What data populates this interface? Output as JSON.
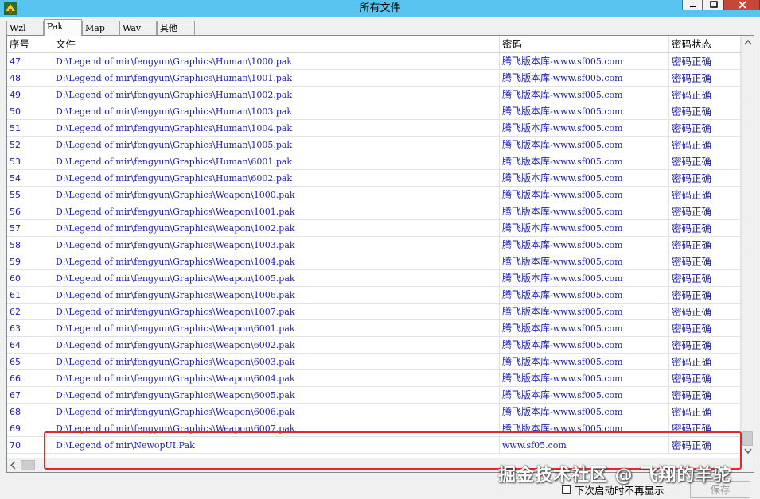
{
  "window": {
    "title": "所有文件"
  },
  "tabs": [
    {
      "label": "Wzl"
    },
    {
      "label": "Pak"
    },
    {
      "label": "Map"
    },
    {
      "label": "Wav"
    },
    {
      "label": "其他"
    }
  ],
  "table": {
    "columns": [
      "序号",
      "文件",
      "密码",
      "密码状态"
    ],
    "rows": [
      {
        "id": "47",
        "file": "D:\\Legend of mir\\fengyun\\Graphics\\Human\\1000.pak",
        "password_cn": "腾飞版本库",
        "password_rest": "-www.sf005.com",
        "status": "密码正确"
      },
      {
        "id": "48",
        "file": "D:\\Legend of mir\\fengyun\\Graphics\\Human\\1001.pak",
        "password_cn": "腾飞版本库",
        "password_rest": "-www.sf005.com",
        "status": "密码正确"
      },
      {
        "id": "49",
        "file": "D:\\Legend of mir\\fengyun\\Graphics\\Human\\1002.pak",
        "password_cn": "腾飞版本库",
        "password_rest": "-www.sf005.com",
        "status": "密码正确"
      },
      {
        "id": "50",
        "file": "D:\\Legend of mir\\fengyun\\Graphics\\Human\\1003.pak",
        "password_cn": "腾飞版本库",
        "password_rest": "-www.sf005.com",
        "status": "密码正确"
      },
      {
        "id": "51",
        "file": "D:\\Legend of mir\\fengyun\\Graphics\\Human\\1004.pak",
        "password_cn": "腾飞版本库",
        "password_rest": "-www.sf005.com",
        "status": "密码正确"
      },
      {
        "id": "52",
        "file": "D:\\Legend of mir\\fengyun\\Graphics\\Human\\1005.pak",
        "password_cn": "腾飞版本库",
        "password_rest": "-www.sf005.com",
        "status": "密码正确"
      },
      {
        "id": "53",
        "file": "D:\\Legend of mir\\fengyun\\Graphics\\Human\\6001.pak",
        "password_cn": "腾飞版本库",
        "password_rest": "-www.sf005.com",
        "status": "密码正确"
      },
      {
        "id": "54",
        "file": "D:\\Legend of mir\\fengyun\\Graphics\\Human\\6002.pak",
        "password_cn": "腾飞版本库",
        "password_rest": "-www.sf005.com",
        "status": "密码正确"
      },
      {
        "id": "55",
        "file": "D:\\Legend of mir\\fengyun\\Graphics\\Weapon\\1000.pak",
        "password_cn": "腾飞版本库",
        "password_rest": "-www.sf005.com",
        "status": "密码正确"
      },
      {
        "id": "56",
        "file": "D:\\Legend of mir\\fengyun\\Graphics\\Weapon\\1001.pak",
        "password_cn": "腾飞版本库",
        "password_rest": "-www.sf005.com",
        "status": "密码正确"
      },
      {
        "id": "57",
        "file": "D:\\Legend of mir\\fengyun\\Graphics\\Weapon\\1002.pak",
        "password_cn": "腾飞版本库",
        "password_rest": "-www.sf005.com",
        "status": "密码正确"
      },
      {
        "id": "58",
        "file": "D:\\Legend of mir\\fengyun\\Graphics\\Weapon\\1003.pak",
        "password_cn": "腾飞版本库",
        "password_rest": "-www.sf005.com",
        "status": "密码正确"
      },
      {
        "id": "59",
        "file": "D:\\Legend of mir\\fengyun\\Graphics\\Weapon\\1004.pak",
        "password_cn": "腾飞版本库",
        "password_rest": "-www.sf005.com",
        "status": "密码正确"
      },
      {
        "id": "60",
        "file": "D:\\Legend of mir\\fengyun\\Graphics\\Weapon\\1005.pak",
        "password_cn": "腾飞版本库",
        "password_rest": "-www.sf005.com",
        "status": "密码正确"
      },
      {
        "id": "61",
        "file": "D:\\Legend of mir\\fengyun\\Graphics\\Weapon\\1006.pak",
        "password_cn": "腾飞版本库",
        "password_rest": "-www.sf005.com",
        "status": "密码正确"
      },
      {
        "id": "62",
        "file": "D:\\Legend of mir\\fengyun\\Graphics\\Weapon\\1007.pak",
        "password_cn": "腾飞版本库",
        "password_rest": "-www.sf005.com",
        "status": "密码正确"
      },
      {
        "id": "63",
        "file": "D:\\Legend of mir\\fengyun\\Graphics\\Weapon\\6001.pak",
        "password_cn": "腾飞版本库",
        "password_rest": "-www.sf005.com",
        "status": "密码正确"
      },
      {
        "id": "64",
        "file": "D:\\Legend of mir\\fengyun\\Graphics\\Weapon\\6002.pak",
        "password_cn": "腾飞版本库",
        "password_rest": "-www.sf005.com",
        "status": "密码正确"
      },
      {
        "id": "65",
        "file": "D:\\Legend of mir\\fengyun\\Graphics\\Weapon\\6003.pak",
        "password_cn": "腾飞版本库",
        "password_rest": "-www.sf005.com",
        "status": "密码正确"
      },
      {
        "id": "66",
        "file": "D:\\Legend of mir\\fengyun\\Graphics\\Weapon\\6004.pak",
        "password_cn": "腾飞版本库",
        "password_rest": "-www.sf005.com",
        "status": "密码正确"
      },
      {
        "id": "67",
        "file": "D:\\Legend of mir\\fengyun\\Graphics\\Weapon\\6005.pak",
        "password_cn": "腾飞版本库",
        "password_rest": "-www.sf005.com",
        "status": "密码正确"
      },
      {
        "id": "68",
        "file": "D:\\Legend of mir\\fengyun\\Graphics\\Weapon\\6006.pak",
        "password_cn": "腾飞版本库",
        "password_rest": "-www.sf005.com",
        "status": "密码正确"
      },
      {
        "id": "69",
        "file": "D:\\Legend of mir\\fengyun\\Graphics\\Weapon\\6007.pak",
        "password_cn": "腾飞版本库",
        "password_rest": "-www.sf005.com",
        "status": "密码正确"
      },
      {
        "id": "70",
        "file": "D:\\Legend of mir\\NewopUI.Pak",
        "password_cn": "",
        "password_rest": "www.sf05.com",
        "status": "密码正确"
      }
    ]
  },
  "footer": {
    "no_show_label": "下次启动时不再显示",
    "save_label": "保存"
  },
  "watermark": {
    "text": "掘金技术社区 @ 飞翔的羊驼"
  },
  "colors": {
    "titlebar": "#56c4ef",
    "row_text": "#1f1fa8",
    "highlight": "#e8262a"
  }
}
